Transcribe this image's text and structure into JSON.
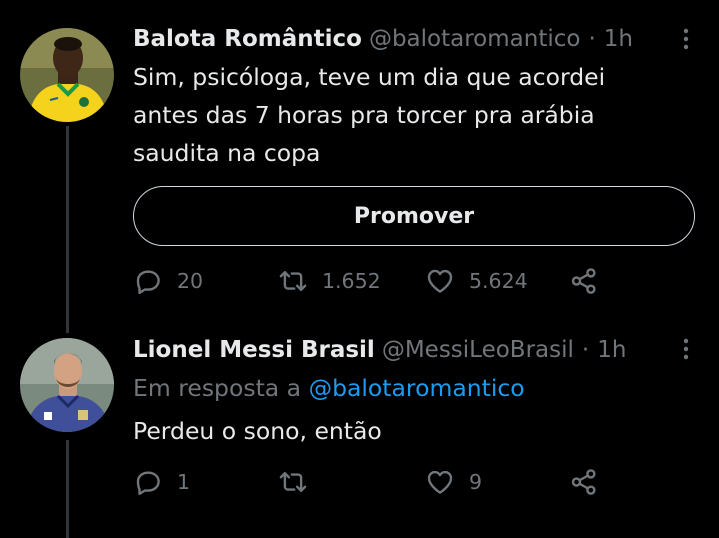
{
  "tweets": [
    {
      "display_name": "Balota Romântico",
      "handle": "@balotaromantico",
      "dot": "·",
      "time": "1h",
      "text": "Sim, psicóloga, teve um dia que acordei\nantes das 7 horas pra torcer pra arábia\nsaudita na copa",
      "promote_label": "Promover",
      "replies": "20",
      "retweets": "1.652",
      "likes": "5.624"
    },
    {
      "display_name": "Lionel Messi Brasil",
      "handle": "@MessiLeoBrasil",
      "dot": "·",
      "time": "1h",
      "reply_prefix": "Em resposta a",
      "reply_mention": "@balotaromantico",
      "text": "Perdeu o sono, então",
      "replies": "1",
      "retweets": "",
      "likes": "9"
    }
  ],
  "colors": {
    "background": "#000000",
    "primary_text": "#e7e9ea",
    "secondary_text": "#71767b",
    "link": "#1d9bf0",
    "thread_line": "#333639"
  },
  "icons": {
    "reply": "reply-icon",
    "retweet": "retweet-icon",
    "like": "heart-icon",
    "share": "share-icon",
    "more": "more-icon"
  }
}
